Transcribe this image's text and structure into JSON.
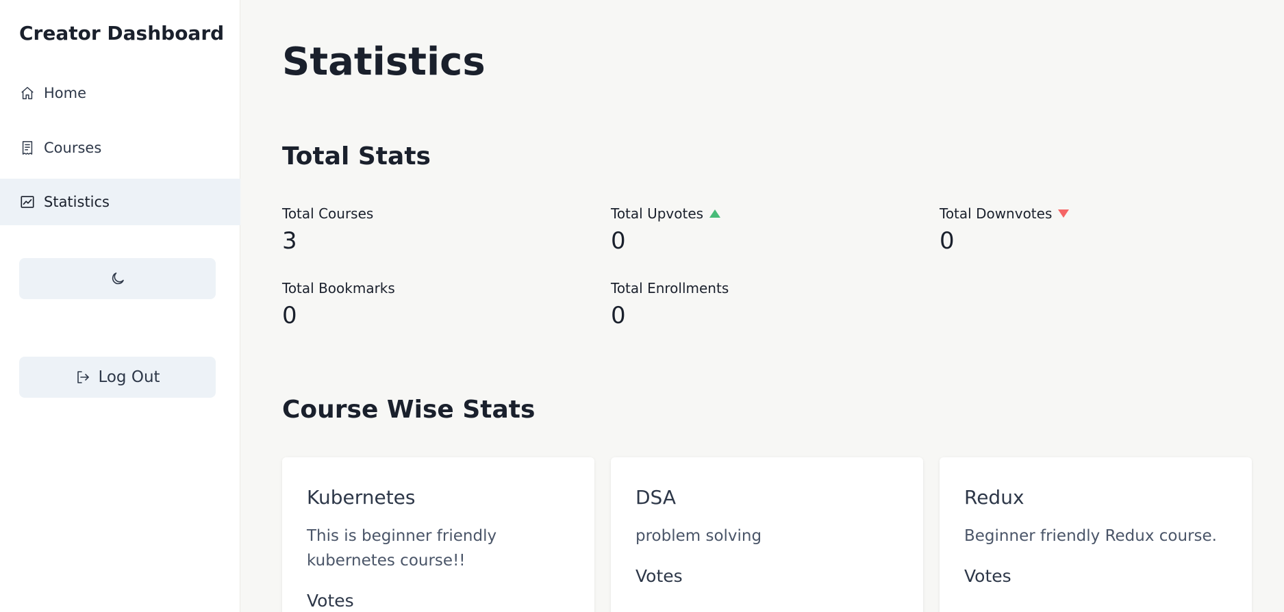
{
  "sidebar": {
    "brand": "Creator Dashboard",
    "items": [
      {
        "label": "Home",
        "icon": "home-icon"
      },
      {
        "label": "Courses",
        "icon": "receipt-icon"
      },
      {
        "label": "Statistics",
        "icon": "chart-line-icon",
        "active": true
      }
    ],
    "theme_toggle_icon": "moon-icon",
    "logout_label": "Log Out",
    "logout_icon": "logout-icon"
  },
  "main": {
    "title": "Statistics",
    "total_stats": {
      "heading": "Total Stats",
      "items": [
        {
          "label": "Total Courses",
          "value": "3"
        },
        {
          "label": "Total Upvotes",
          "value": "0",
          "indicator": "up-arrow"
        },
        {
          "label": "Total Downvotes",
          "value": "0",
          "indicator": "down-arrow"
        },
        {
          "label": "Total Bookmarks",
          "value": "0"
        },
        {
          "label": "Total Enrollments",
          "value": "0"
        }
      ]
    },
    "course_stats": {
      "heading": "Course Wise Stats",
      "courses": [
        {
          "title": "Kubernetes",
          "description": "This is beginner friendly kubernetes course!!",
          "votes_label": "Votes"
        },
        {
          "title": "DSA",
          "description": "problem solving",
          "votes_label": "Votes"
        },
        {
          "title": "Redux",
          "description": "Beginner friendly Redux course.",
          "votes_label": "Votes"
        }
      ]
    }
  },
  "colors": {
    "up": "#48bb78",
    "down": "#f56565",
    "active_bg": "#edf2f7",
    "page_bg": "#f7f7f5"
  }
}
